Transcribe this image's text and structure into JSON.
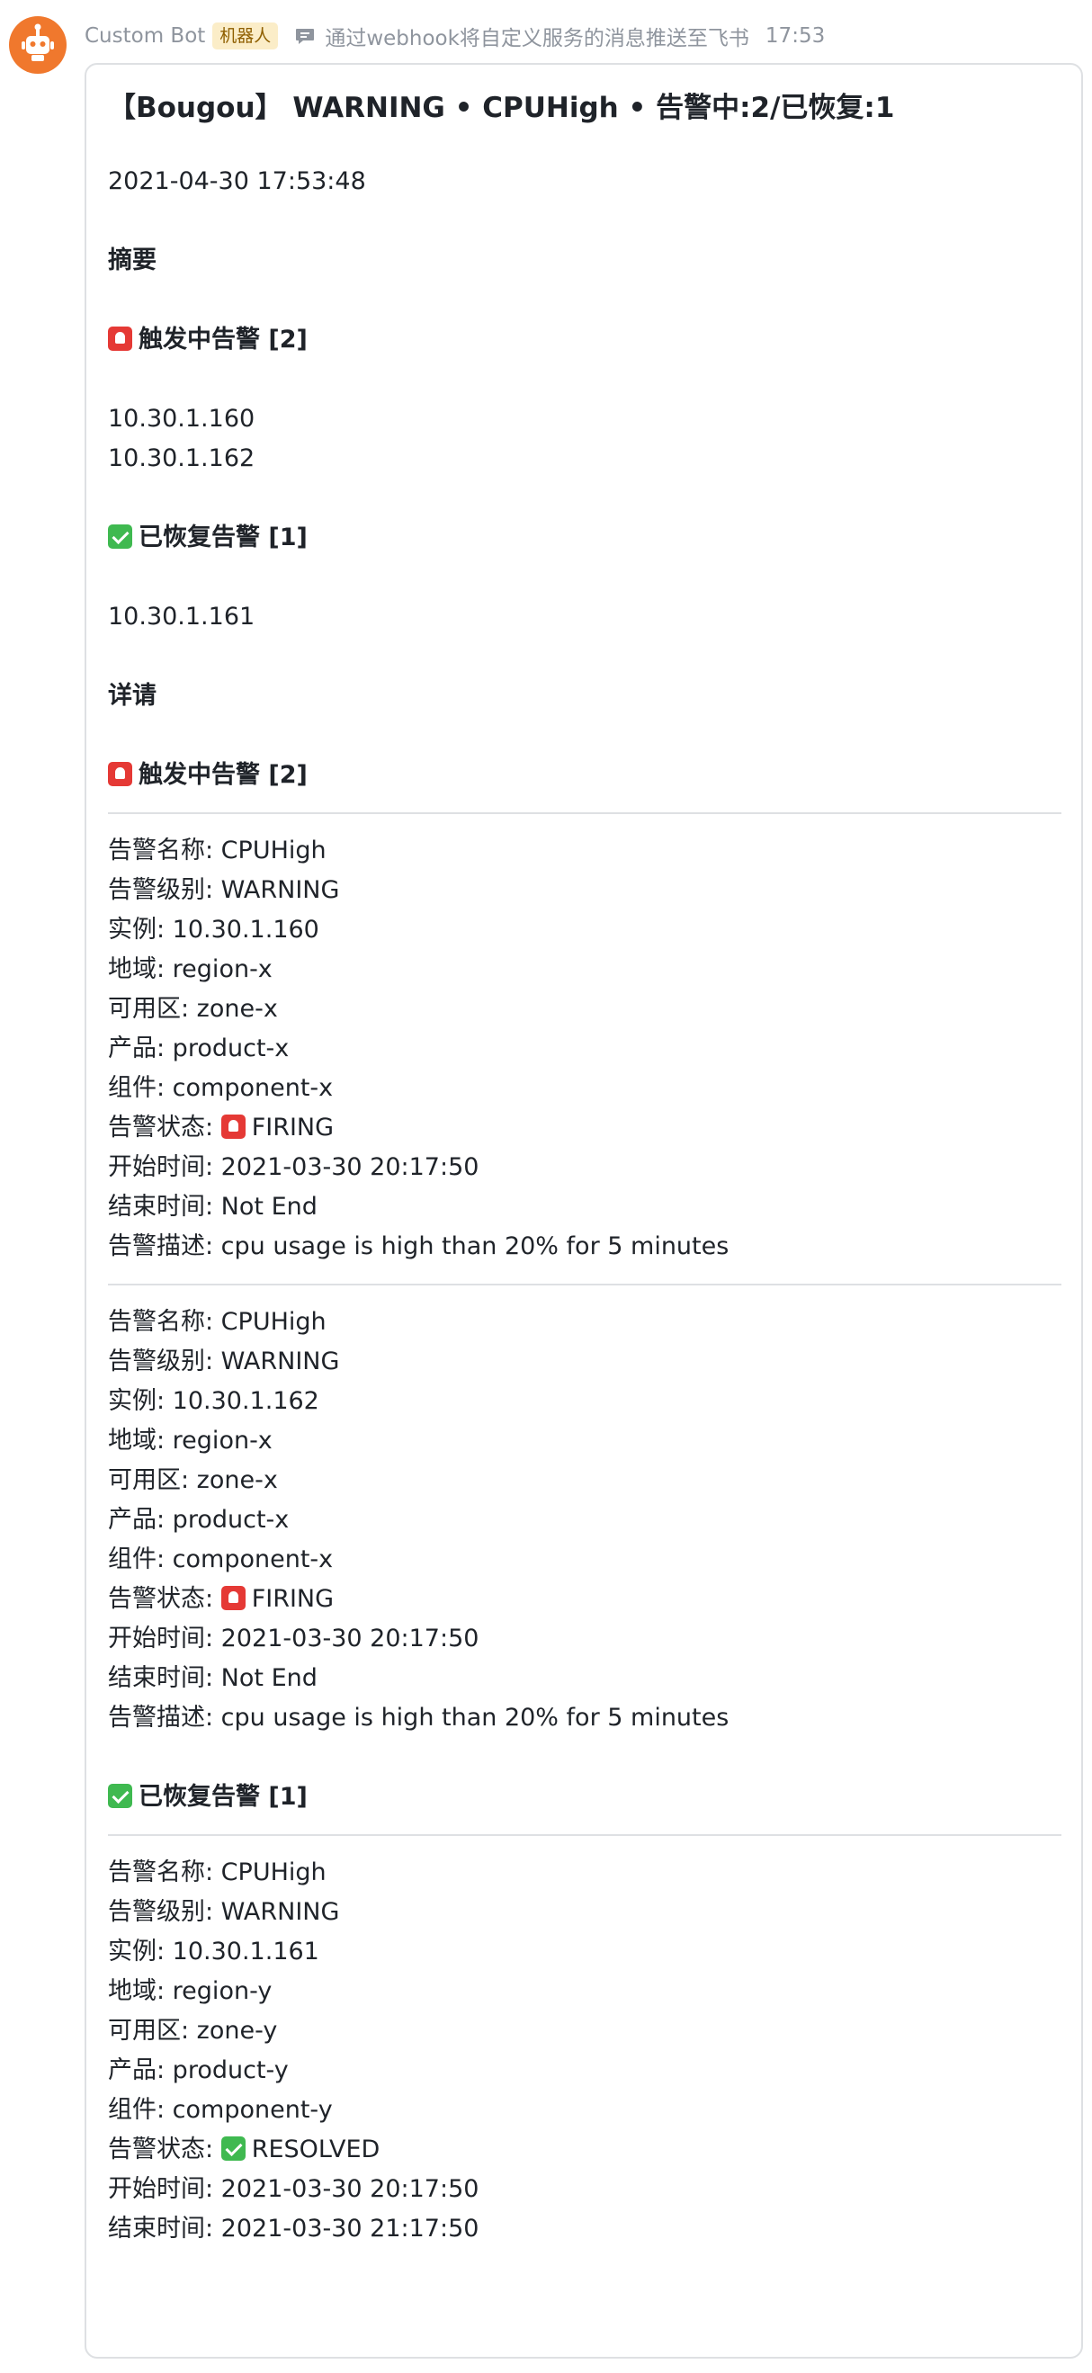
{
  "sender": {
    "name": "Custom Bot",
    "badge": "机器人",
    "source_icon": "message-icon",
    "source": "通过webhook将自定义服务的消息推送至飞书",
    "time": "17:53",
    "avatar_icon": "robot-icon",
    "avatar_color": "#f0782d"
  },
  "card": {
    "title": "【Bougou】 WARNING • CPUHigh • 告警中:2/已恢复:1",
    "datetime": "2021-04-30 17:53:48",
    "summary": {
      "heading": "摘要",
      "firing_heading": "触发中告警 [2]",
      "firing_instances": [
        "10.30.1.160",
        "10.30.1.162"
      ],
      "resolved_heading": "已恢复告警 [1]",
      "resolved_instances": [
        "10.30.1.161"
      ]
    },
    "details": {
      "heading": "详请",
      "firing_heading": "触发中告警 [2]",
      "firing_alerts": [
        [
          "告警名称: CPUHigh",
          "告警级别: WARNING",
          "实例: 10.30.1.160",
          "地域: region-x",
          "可用区: zone-x",
          "产品: product-x",
          "组件: component-x",
          "告警状态:",
          "开始时间: 2021-03-30 20:17:50",
          "结束时间: Not End",
          "告警描述: cpu usage is high than 20% for 5 minutes"
        ],
        [
          "告警名称: CPUHigh",
          "告警级别: WARNING",
          "实例: 10.30.1.162",
          "地域: region-x",
          "可用区: zone-x",
          "产品: product-x",
          "组件: component-x",
          "告警状态:",
          "开始时间: 2021-03-30 20:17:50",
          "结束时间: Not End",
          "告警描述: cpu usage is high than 20% for 5 minutes"
        ]
      ],
      "firing_status": "FIRING",
      "resolved_heading": "已恢复告警 [1]",
      "resolved_alerts": [
        [
          "告警名称: CPUHigh",
          "告警级别: WARNING",
          "实例: 10.30.1.161",
          "地域: region-y",
          "可用区: zone-y",
          "产品: product-y",
          "组件: component-y",
          "告警状态:",
          "开始时间: 2021-03-30 20:17:50",
          "结束时间: 2021-03-30 21:17:50"
        ]
      ],
      "resolved_status": "RESOLVED"
    },
    "emoji": {
      "firing": "rotating-light-emoji",
      "resolved": "check-mark-emoji"
    },
    "colors": {
      "firing": "#e53935",
      "resolved": "#3fb950"
    }
  }
}
